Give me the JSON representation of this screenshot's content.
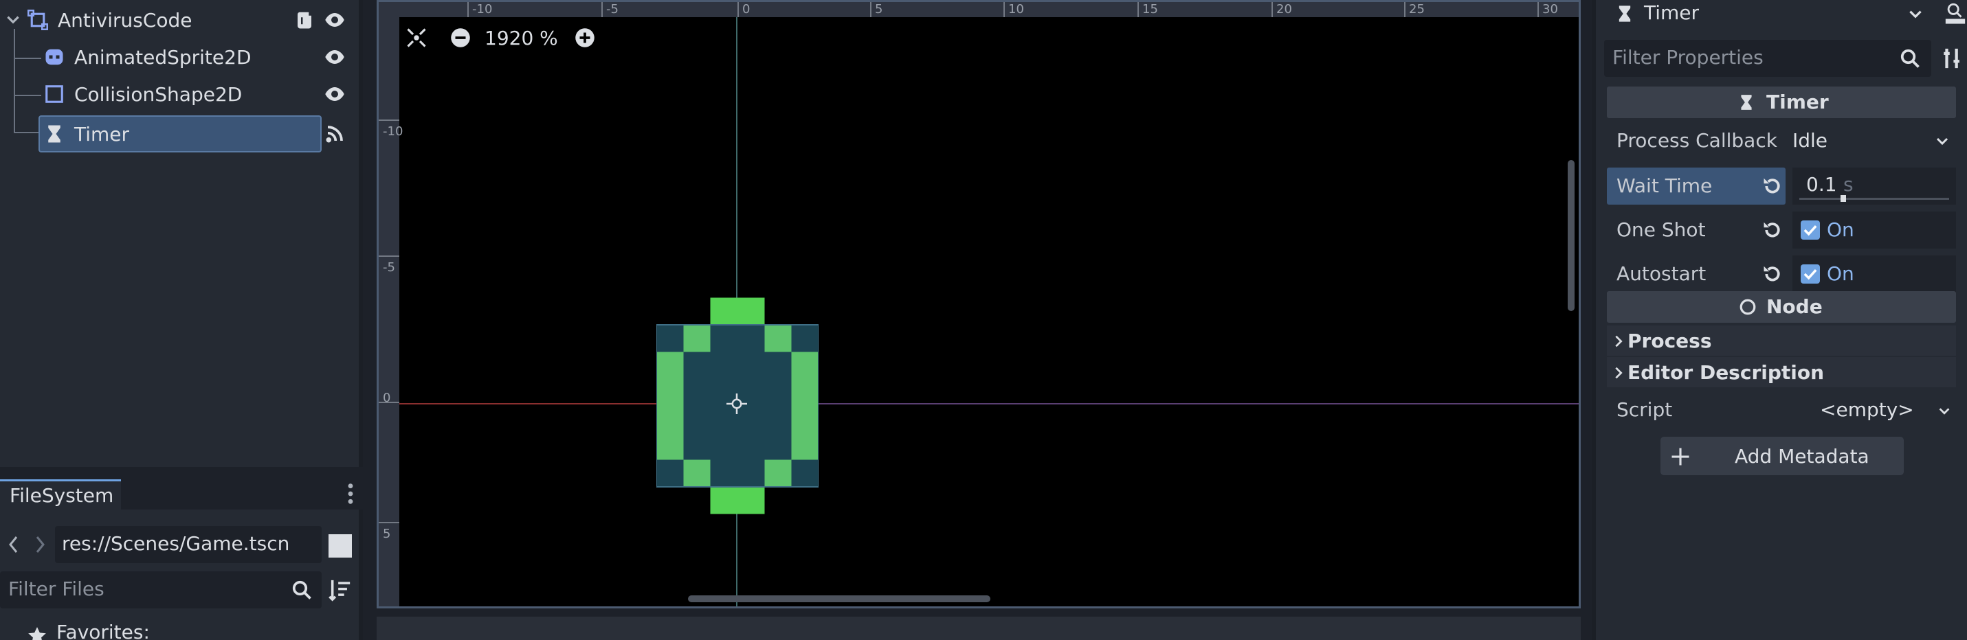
{
  "scene_tree": {
    "root": "AntivirusCode",
    "children": [
      "AnimatedSprite2D",
      "CollisionShape2D",
      "Timer"
    ],
    "selected": "Timer"
  },
  "filesystem": {
    "tab": "FileSystem",
    "path": "res://Scenes/Game.tscn",
    "filter_placeholder": "Filter Files",
    "favorites": "Favorites:"
  },
  "viewport": {
    "zoom": "1920 %",
    "ruler_top_ticks": [
      "-10",
      "-5",
      "0",
      "5",
      "10",
      "15",
      "20",
      "25",
      "30"
    ],
    "ruler_left_ticks": [
      "-10",
      "-5",
      "0",
      "5"
    ]
  },
  "inspector": {
    "node_type": "Timer",
    "filter_placeholder": "Filter Properties",
    "section_timer": "Timer",
    "process_callback_label": "Process Callback",
    "process_callback_value": "Idle",
    "wait_time_label": "Wait Time",
    "wait_time_value": "0.1",
    "wait_time_unit": "s",
    "one_shot_label": "One Shot",
    "one_shot_value": "On",
    "autostart_label": "Autostart",
    "autostart_value": "On",
    "section_node": "Node",
    "process_label": "Process",
    "editor_description_label": "Editor Description",
    "script_label": "Script",
    "script_value": "<empty>",
    "add_metadata": "Add Metadata"
  },
  "colors": {
    "accent": "#6fa3e2",
    "sprite_light": "#5ec46d",
    "sprite_dark": "#1c4452",
    "sprite_top": "#55d354"
  }
}
